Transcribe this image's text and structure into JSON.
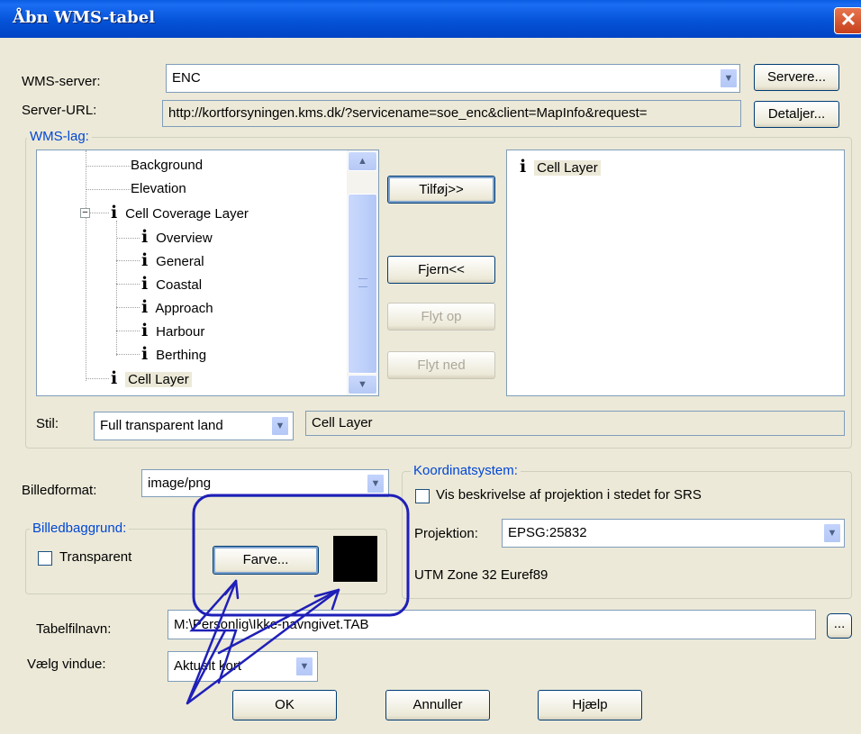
{
  "window": {
    "title": "Åbn WMS-tabel",
    "close_glyph": "✕"
  },
  "wms_server": {
    "label": "WMS-server:",
    "value": "ENC",
    "button": "Servere..."
  },
  "server_url": {
    "label": "Server-URL:",
    "value": "http://kortforsyningen.kms.dk/?servicename=soe_enc&client=MapInfo&request=",
    "button": "Detaljer..."
  },
  "wms_layers": {
    "group_title": "WMS-lag:",
    "tree": [
      {
        "label": "Background",
        "icon": "none",
        "level": 1
      },
      {
        "label": "Elevation",
        "icon": "none",
        "level": 1
      },
      {
        "label": "Cell Coverage Layer",
        "icon": "info-icon",
        "level": 1,
        "expander": "minus-icon"
      },
      {
        "label": "Overview",
        "icon": "info-icon",
        "level": 2
      },
      {
        "label": "General",
        "icon": "info-icon",
        "level": 2
      },
      {
        "label": "Coastal",
        "icon": "info-icon",
        "level": 2
      },
      {
        "label": "Approach",
        "icon": "info-icon",
        "level": 2
      },
      {
        "label": "Harbour",
        "icon": "info-icon",
        "level": 2
      },
      {
        "label": "Berthing",
        "icon": "info-icon",
        "level": 2
      },
      {
        "label": "Cell Layer",
        "icon": "info-icon",
        "level": 1,
        "selected": true
      }
    ],
    "buttons": {
      "add": "Tilføj>>",
      "remove": "Fjern<<",
      "move_up": "Flyt op",
      "move_down": "Flyt ned"
    },
    "selected_layers": [
      {
        "label": "Cell Layer",
        "icon": "info-icon"
      }
    ],
    "style_label": "Stil:",
    "style_value": "Full transparent land",
    "style_layer": "Cell Layer"
  },
  "image_format": {
    "label": "Billedformat:",
    "value": "image/png"
  },
  "image_background": {
    "group_title": "Billedbaggrund:",
    "transparent_label": "Transparent",
    "transparent_checked": false,
    "color_button": "Farve...",
    "color_swatch": "#000000"
  },
  "coordinate_system": {
    "group_title": "Koordinatsystem:",
    "checkbox_label": "Vis beskrivelse af projektion i stedet for SRS",
    "checkbox_checked": false,
    "projection_label": "Projektion:",
    "projection_value": "EPSG:25832",
    "projection_description": "UTM Zone 32 Euref89"
  },
  "table_file": {
    "label": "Tabelfilnavn:",
    "value": "M:\\Personlig\\Ikke-navngivet.TAB",
    "browse_button": "..."
  },
  "choose_window": {
    "label": "Vælg vindue:",
    "value": "Aktuelt kort"
  },
  "footer": {
    "ok": "OK",
    "cancel": "Annuller",
    "help": "Hjælp"
  },
  "colors": {
    "annotation": "#1f1fb8",
    "title_bar": "#0553d8",
    "group_title": "#0046d5"
  }
}
